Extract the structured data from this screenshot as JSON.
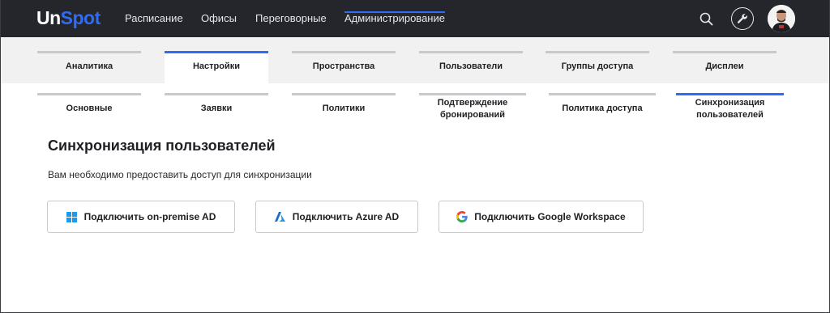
{
  "app": {
    "logo_main": "Un",
    "logo_accent": "Spot"
  },
  "nav": {
    "items": [
      {
        "label": "Расписание"
      },
      {
        "label": "Офисы"
      },
      {
        "label": "Переговорные"
      },
      {
        "label": "Администрирование",
        "active": true
      }
    ]
  },
  "primary_tabs": [
    {
      "label": "Аналитика"
    },
    {
      "label": "Настройки",
      "active": true
    },
    {
      "label": "Пространства"
    },
    {
      "label": "Пользователи"
    },
    {
      "label": "Группы доступа"
    },
    {
      "label": "Дисплеи"
    }
  ],
  "secondary_tabs": [
    {
      "label": "Основные"
    },
    {
      "label": "Заявки"
    },
    {
      "label": "Политики"
    },
    {
      "label_line1": "Подтверждение",
      "label_line2": "бронирований"
    },
    {
      "label": "Политика доступа"
    },
    {
      "label_line1": "Синхронизация",
      "label_line2": "пользователей",
      "active": true
    }
  ],
  "page": {
    "title": "Синхронизация пользователей",
    "description": "Вам необходимо предоставить доступ для синхронизации"
  },
  "buttons": [
    {
      "label": "Подключить on-premise AD",
      "icon": "windows-icon"
    },
    {
      "label": "Подключить Azure AD",
      "icon": "azure-icon"
    },
    {
      "label": "Подключить Google Workspace",
      "icon": "google-icon"
    }
  ],
  "colors": {
    "accent": "#2f6cf6",
    "topbar": "#25262b",
    "tabs_bg": "#f1f1f2",
    "tab_inactive_bar": "#c8c9cc"
  }
}
